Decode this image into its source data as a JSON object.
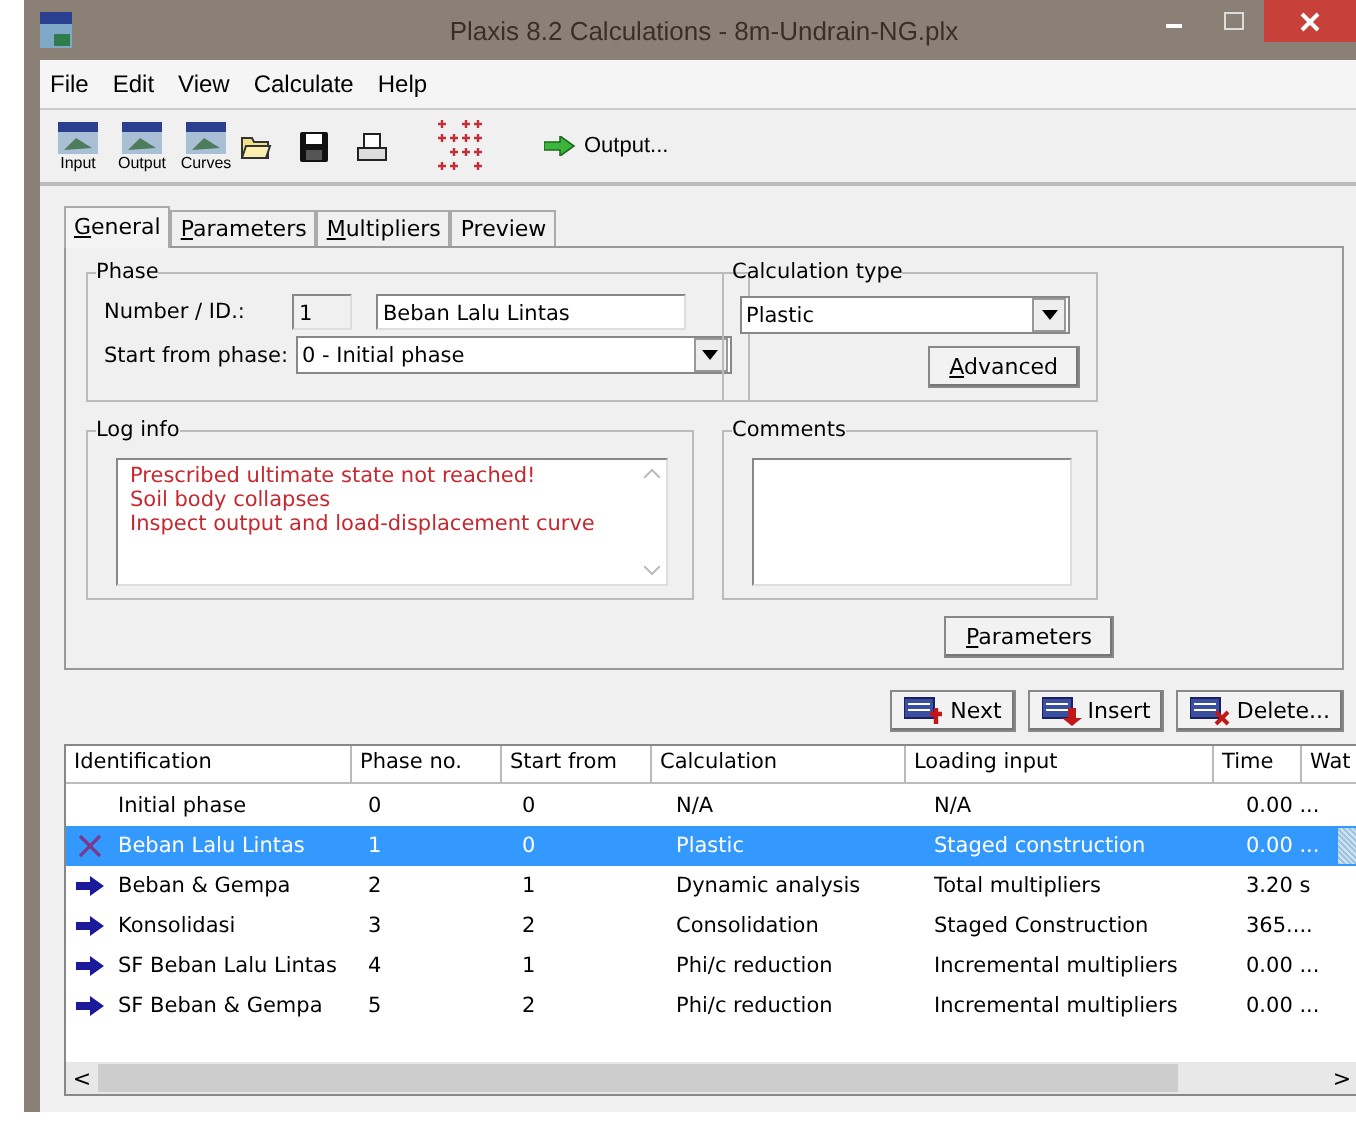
{
  "window": {
    "title": "Plaxis 8.2 Calculations - 8m-Undrain-NG.plx"
  },
  "menu": [
    "File",
    "Edit",
    "View",
    "Calculate",
    "Help"
  ],
  "toolbar": [
    {
      "kind": "app",
      "label": "Input"
    },
    {
      "kind": "app",
      "label": "Output"
    },
    {
      "kind": "app",
      "label": "Curves"
    },
    {
      "kind": "open"
    },
    {
      "kind": "save"
    },
    {
      "kind": "print"
    },
    {
      "kind": "points"
    },
    {
      "kind": "output",
      "label": "Output..."
    }
  ],
  "tabs": [
    {
      "label": "General",
      "underlined": true,
      "selected": true
    },
    {
      "label": "Parameters",
      "underlined": true,
      "selected": false
    },
    {
      "label": "Multipliers",
      "underlined": true,
      "selected": false
    },
    {
      "label": "Preview",
      "underlined": false,
      "selected": false
    }
  ],
  "phase": {
    "title": "Phase",
    "number_label": "Number / ID.:",
    "number": "1",
    "id": "Beban Lalu Lintas",
    "start_label": "Start from phase:",
    "start": "0 - Initial phase"
  },
  "calculation_type": {
    "title": "Calculation type",
    "value": "Plastic",
    "advanced": {
      "label": "Advanced",
      "underlined": true
    }
  },
  "log_info": {
    "title": "Log info",
    "lines": [
      "Prescribed ultimate state not reached!",
      "Soil body collapses",
      "Inspect output and load-displacement curve"
    ]
  },
  "comments": {
    "title": "Comments"
  },
  "parameters_button": {
    "label": "Parameters",
    "underlined": true
  },
  "phase_buttons": [
    {
      "kind": "next",
      "label": "Next"
    },
    {
      "kind": "insert",
      "label": "Insert"
    },
    {
      "kind": "delete",
      "label": "Delete..."
    }
  ],
  "table": {
    "columns": [
      "Identification",
      "Phase no.",
      "Start from",
      "Calculation",
      "Loading input",
      "Time",
      "Wat"
    ],
    "rows": [
      {
        "kind": "none",
        "selected": false,
        "cells": [
          "Initial phase",
          "0",
          "0",
          "N/A",
          "N/A",
          "0.00 ..."
        ]
      },
      {
        "kind": "failed",
        "selected": true,
        "cells": [
          "Beban Lalu Lintas",
          "1",
          "0",
          "Plastic",
          "Staged construction",
          "0.00 ..."
        ]
      },
      {
        "kind": "arrow",
        "selected": false,
        "cells": [
          "Beban & Gempa",
          "2",
          "1",
          "Dynamic analysis",
          "Total multipliers",
          "3.20 s"
        ]
      },
      {
        "kind": "arrow",
        "selected": false,
        "cells": [
          "Konsolidasi",
          "3",
          "2",
          "Consolidation",
          "Staged Construction",
          "365...."
        ]
      },
      {
        "kind": "arrow",
        "selected": false,
        "cells": [
          "SF Beban Lalu Lintas",
          "4",
          "1",
          "Phi/c reduction",
          "Incremental multipliers",
          "0.00 ..."
        ]
      },
      {
        "kind": "arrow",
        "selected": false,
        "cells": [
          "SF Beban & Gempa",
          "5",
          "2",
          "Phi/c reduction",
          "Incremental multipliers",
          "0.00 ..."
        ]
      }
    ]
  },
  "scrollbar": {
    "left": "<",
    "right": ">"
  }
}
